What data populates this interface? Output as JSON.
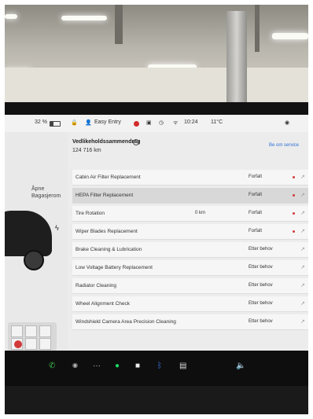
{
  "status_bar": {
    "battery_percent": "32 %",
    "profile": "Easy Entry",
    "time": "10:24",
    "temperature": "11°C"
  },
  "car_panel": {
    "trunk_label": "Åpne\nBagasjerom"
  },
  "maintenance": {
    "title": "Vedlikeholdssammendrag",
    "odometer": "124 716  km",
    "service_link": "Be om service",
    "items": [
      {
        "name": "Cabin Air Filter Replacement",
        "last": "",
        "status": "Forfalt",
        "selected": false
      },
      {
        "name": "HEPA Filter Replacement",
        "last": "",
        "status": "Forfalt",
        "selected": true
      },
      {
        "name": "Tire Rotation",
        "last": "0 km",
        "status": "Forfalt",
        "selected": false
      },
      {
        "name": "Wiper Blades Replacement",
        "last": "",
        "status": "Forfalt",
        "selected": false
      },
      {
        "name": "Brake Cleaning & Lubrication",
        "last": "",
        "status": "Etter behov",
        "selected": false
      },
      {
        "name": "Low Voltage Battery Replacement",
        "last": "",
        "status": "Etter behov",
        "selected": false
      },
      {
        "name": "Radiator Cleaning",
        "last": "",
        "status": "Etter behov",
        "selected": false
      },
      {
        "name": "Wheel Alignment Check",
        "last": "",
        "status": "Etter behov",
        "selected": false
      },
      {
        "name": "Windshield Camera Area Precision Cleaning",
        "last": "",
        "status": "Etter behov",
        "selected": false
      }
    ]
  },
  "taskbar_icons": [
    "phone-icon",
    "camera-icon",
    "more-icon",
    "spotify-icon",
    "app-icon",
    "bluetooth-icon",
    "calendar-icon",
    "volume-icon"
  ]
}
